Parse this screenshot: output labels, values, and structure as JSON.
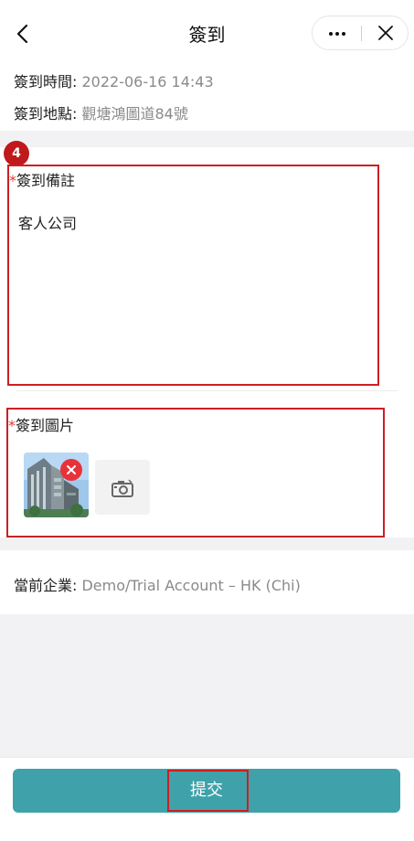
{
  "header": {
    "title": "簽到",
    "back_icon": "chevron-left-icon",
    "more_icon": "more-dots-icon",
    "close_icon": "close-icon"
  },
  "checkin": {
    "time_label": "簽到時間: ",
    "time_value": "2022-06-16 14:43",
    "place_label": "簽到地點: ",
    "place_value": "觀塘鴻圖道84號"
  },
  "annotation": {
    "step_badge": "4"
  },
  "remark": {
    "required_mark": "*",
    "label": "簽到備註",
    "value": "客人公司"
  },
  "photos": {
    "required_mark": "*",
    "label": "簽到圖片",
    "remove_icon": "remove-x-icon",
    "add_icon": "camera-icon"
  },
  "company": {
    "label": "當前企業: ",
    "value": "Demo/Trial Account – HK (Chi)"
  },
  "footer": {
    "submit_label": "提交"
  },
  "colors": {
    "accent": "#3fa2aa",
    "annotation_red": "#cc1f24",
    "remove_red": "#e8323a",
    "muted_text": "#8a8a8a",
    "section_bg": "#f2f2f4"
  }
}
